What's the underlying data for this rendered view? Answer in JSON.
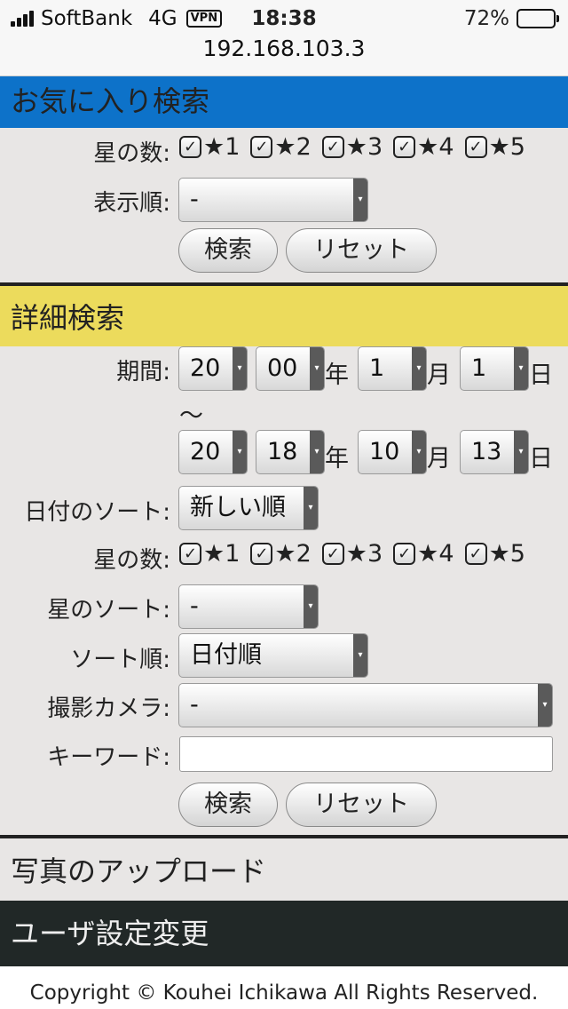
{
  "status_bar": {
    "carrier": "SoftBank",
    "network": "4G",
    "vpn": "VPN",
    "time": "18:38",
    "battery": "72%",
    "battery_level": 0.72,
    "url": "192.168.103.3"
  },
  "favorites": {
    "title": "お気に入り検索",
    "stars_label": "星の数:",
    "stars": [
      "★1",
      "★2",
      "★3",
      "★4",
      "★5"
    ],
    "order_label": "表示順:",
    "order_value": "-",
    "search_button": "検索",
    "reset_button": "リセット"
  },
  "detail": {
    "title": "詳細検索",
    "period_label": "期間:",
    "start": {
      "century": "20",
      "year": "00",
      "month": "1",
      "day": "1"
    },
    "tilde": "〜",
    "end": {
      "century": "20",
      "year": "18",
      "month": "10",
      "day": "13"
    },
    "unit_year": "年",
    "unit_month": "月",
    "unit_day": "日",
    "date_sort_label": "日付のソート:",
    "date_sort_value": "新しい順",
    "stars_label": "星の数:",
    "stars": [
      "★1",
      "★2",
      "★3",
      "★4",
      "★5"
    ],
    "star_sort_label": "星のソート:",
    "star_sort_value": "-",
    "sort_order_label": "ソート順:",
    "sort_order_value": "日付順",
    "camera_label": "撮影カメラ:",
    "camera_value": "-",
    "keyword_label": "キーワード:",
    "keyword_value": "",
    "search_button": "検索",
    "reset_button": "リセット"
  },
  "nav": {
    "upload": "写真のアップロード",
    "user_settings": "ユーザ設定変更"
  },
  "footer": {
    "copyright": "Copyright © Kouhei Ichikawa All Rights Reserved."
  }
}
